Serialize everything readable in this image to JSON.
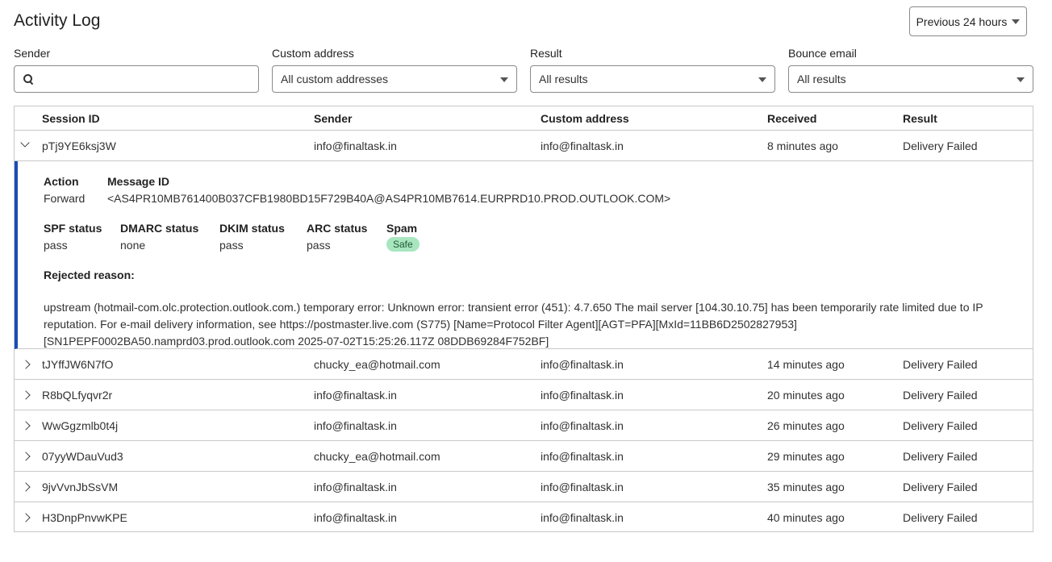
{
  "page": {
    "title": "Activity Log",
    "range_label": "Previous 24 hours"
  },
  "filters": {
    "sender": {
      "label": "Sender",
      "value": "",
      "placeholder": ""
    },
    "custom_address": {
      "label": "Custom address",
      "value": "All custom addresses"
    },
    "result": {
      "label": "Result",
      "value": "All results"
    },
    "bounce": {
      "label": "Bounce email",
      "value": "All results"
    }
  },
  "table": {
    "headers": {
      "session": "Session ID",
      "sender": "Sender",
      "custom": "Custom address",
      "received": "Received",
      "result": "Result"
    },
    "rows": [
      {
        "session": "pTj9YE6ksj3W",
        "sender": "info@finaltask.in",
        "custom": "info@finaltask.in",
        "received": "8 minutes ago",
        "result": "Delivery Failed"
      },
      {
        "session": "tJYffJW6N7fO",
        "sender": "chucky_ea@hotmail.com",
        "custom": "info@finaltask.in",
        "received": "14 minutes ago",
        "result": "Delivery Failed"
      },
      {
        "session": "R8bQLfyqvr2r",
        "sender": "info@finaltask.in",
        "custom": "info@finaltask.in",
        "received": "20 minutes ago",
        "result": "Delivery Failed"
      },
      {
        "session": "WwGgzmlb0t4j",
        "sender": "info@finaltask.in",
        "custom": "info@finaltask.in",
        "received": "26 minutes ago",
        "result": "Delivery Failed"
      },
      {
        "session": "07yyWDauVud3",
        "sender": "chucky_ea@hotmail.com",
        "custom": "info@finaltask.in",
        "received": "29 minutes ago",
        "result": "Delivery Failed"
      },
      {
        "session": "9jvVvnJbSsVM",
        "sender": "info@finaltask.in",
        "custom": "info@finaltask.in",
        "received": "35 minutes ago",
        "result": "Delivery Failed"
      },
      {
        "session": "H3DnpPnvwKPE",
        "sender": "info@finaltask.in",
        "custom": "info@finaltask.in",
        "received": "40 minutes ago",
        "result": "Delivery Failed"
      }
    ]
  },
  "detail": {
    "action_label": "Action",
    "action": "Forward",
    "message_id_label": "Message ID",
    "message_id": "<AS4PR10MB761400B037CFB1980BD15F729B40A@AS4PR10MB7614.EURPRD10.PROD.OUTLOOK.COM>",
    "spf_label": "SPF status",
    "spf": "pass",
    "dmarc_label": "DMARC status",
    "dmarc": "none",
    "dkim_label": "DKIM status",
    "dkim": "pass",
    "arc_label": "ARC status",
    "arc": "pass",
    "spam_label": "Spam",
    "spam": "Safe",
    "rejected_label": "Rejected reason:",
    "rejected": "upstream (hotmail-com.olc.protection.outlook.com.) temporary error: Unknown error: transient error (451): 4.7.650 The mail server [104.30.10.75] has been temporarily rate limited due to IP reputation. For e-mail delivery information, see https://postmaster.live.com (S775) [Name=Protocol Filter Agent][AGT=PFA][MxId=11BB6D2502827953] [SN1PEPF0002BA50.namprd03.prod.outlook.com 2025-07-02T15:25:26.117Z 08DDB69284F752BF]"
  }
}
